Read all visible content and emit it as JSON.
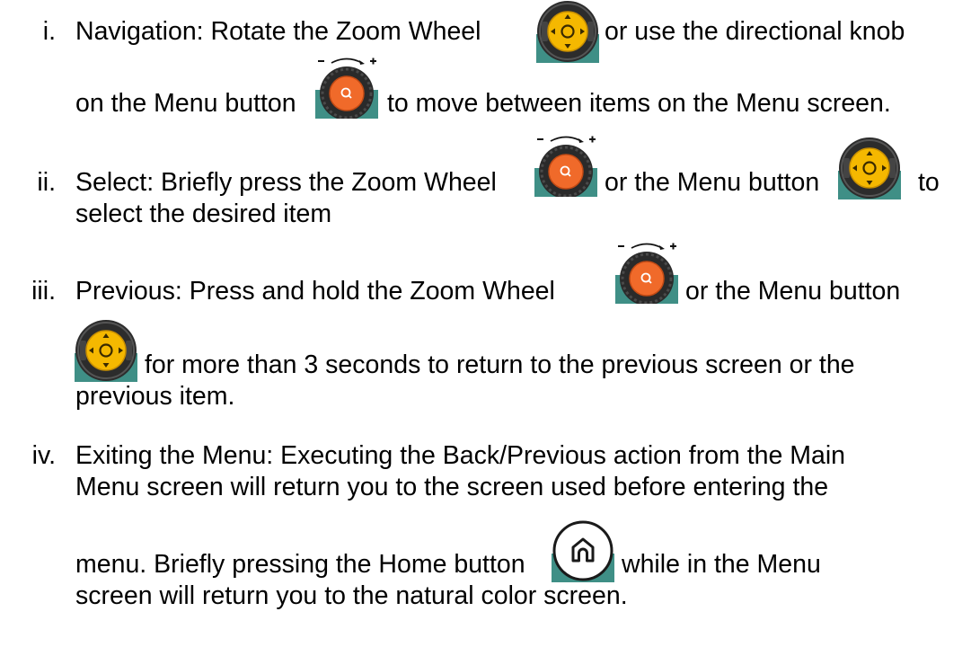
{
  "items": [
    {
      "numeral": "i.",
      "lines": [
        {
          "before": "Navigation: Rotate the Zoom Wheel",
          "after": "or use the directional knob"
        },
        {
          "before": "on the Menu button",
          "after": "to move between items on the Menu screen."
        }
      ]
    },
    {
      "numeral": "ii.",
      "lines": [
        {
          "before": "Select: Briefly press the Zoom Wheel",
          "middle": "or the Menu button",
          "after": "to"
        },
        {
          "text": "select the desired item"
        }
      ]
    },
    {
      "numeral": "iii.",
      "lines": [
        {
          "before": "Previous: Press and hold the Zoom Wheel",
          "after": "or the Menu button"
        },
        {
          "after": "for more than 3 seconds to return to the previous screen or the"
        },
        {
          "text": "previous item."
        }
      ]
    },
    {
      "numeral": "iv.",
      "lines": [
        {
          "text": "Exiting the Menu: Executing the Back/Previous action from the Main"
        },
        {
          "text": "Menu screen will return you to the screen used before entering the"
        },
        {
          "before": "menu. Briefly pressing the Home button",
          "after": "while in the Menu"
        },
        {
          "text": "screen will return you to the natural color screen."
        }
      ]
    }
  ],
  "colors": {
    "dpad_yellow": "#f5b800",
    "zoom_orange": "#f06a2a",
    "bezel_dark": "#2a2a2a",
    "panel_teal": "#3f8f86"
  },
  "icons": [
    "dpad-menu-button-icon",
    "zoom-wheel-icon",
    "home-button-icon"
  ]
}
